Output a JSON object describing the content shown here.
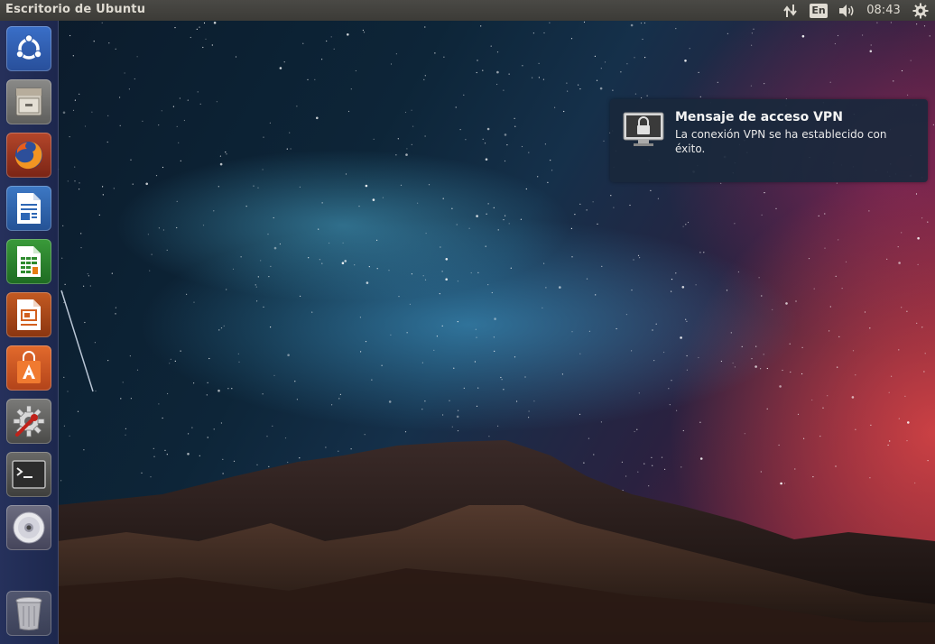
{
  "panel": {
    "title": "Escritorio de Ubuntu",
    "keyboard_layout": "En",
    "clock": "08:43",
    "indicators": [
      "network-icon",
      "keyboard-layout",
      "volume-icon",
      "clock",
      "session-gear-icon"
    ],
    "bg_color": "#3c3b37",
    "text_color": "#dfdbd2"
  },
  "launcher": {
    "items": [
      {
        "name": "dash-home",
        "icon": "ubuntu-logo-icon"
      },
      {
        "name": "files",
        "icon": "file-cabinet-icon"
      },
      {
        "name": "firefox",
        "icon": "firefox-icon"
      },
      {
        "name": "libreoffice-writer",
        "icon": "writer-document-icon"
      },
      {
        "name": "libreoffice-calc",
        "icon": "calc-spreadsheet-icon"
      },
      {
        "name": "libreoffice-impress",
        "icon": "impress-presentation-icon"
      },
      {
        "name": "ubuntu-software-center",
        "icon": "shopping-bag-icon"
      },
      {
        "name": "system-settings",
        "icon": "gear-wrench-icon"
      },
      {
        "name": "terminal",
        "icon": "terminal-icon"
      },
      {
        "name": "disc",
        "icon": "optical-disc-icon"
      },
      {
        "name": "trash",
        "icon": "trash-icon"
      }
    ],
    "accent": "#2b3a78"
  },
  "notification": {
    "title": "Mensaje de acceso VPN",
    "body": "La conexión VPN se ha establecido con éxito.",
    "icon": "vpn-lock-icon"
  }
}
